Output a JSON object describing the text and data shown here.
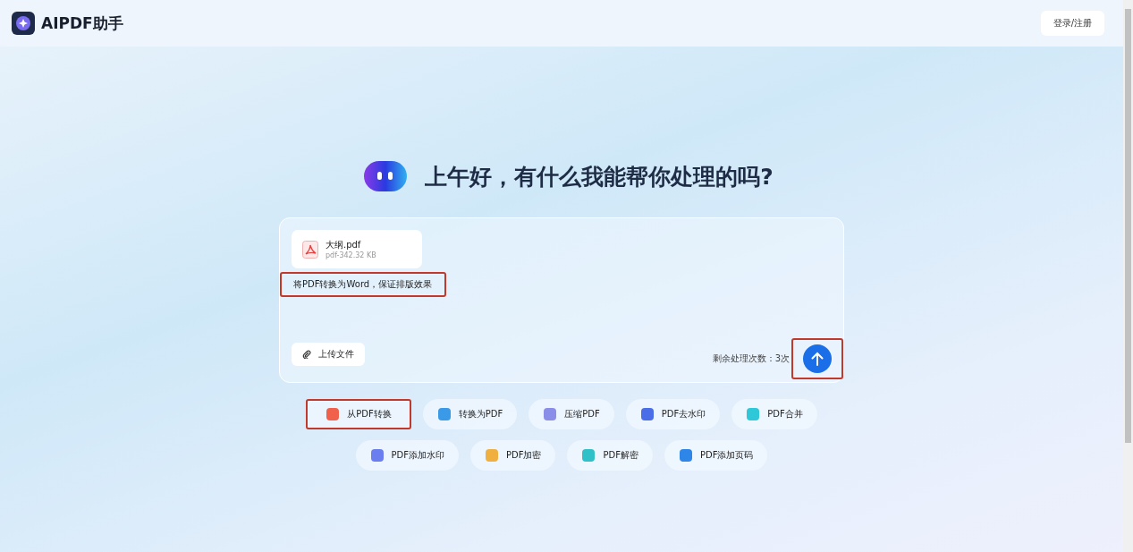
{
  "header": {
    "logo": "AIPDF助手",
    "login": "登录/注册"
  },
  "greeting": "上午好，有什么我能帮你处理的吗?",
  "composer": {
    "file": {
      "name": "大纲.pdf",
      "meta": "pdf-342.32 KB"
    },
    "prompt": {
      "text": "将PDF转换为Word，保证排版效果",
      "highlighted": true
    },
    "upload": "上传文件",
    "remaining": "剩余处理次数：3次",
    "send_highlighted": true
  },
  "tool_rows": [
    [
      {
        "label": "从PDF转换",
        "color": "#f0604a",
        "highlighted": true
      },
      {
        "label": "转换为PDF",
        "color": "#3a9ae8",
        "highlighted": false
      },
      {
        "label": "压缩PDF",
        "color": "#8a8ee8",
        "highlighted": false
      },
      {
        "label": "PDF去水印",
        "color": "#4a6ee8",
        "highlighted": false
      },
      {
        "label": "PDF合并",
        "color": "#2ec8d8",
        "highlighted": false
      }
    ],
    [
      {
        "label": "PDF添加水印",
        "color": "#6a7ef0",
        "highlighted": false
      },
      {
        "label": "PDF加密",
        "color": "#f0b040",
        "highlighted": false
      },
      {
        "label": "PDF解密",
        "color": "#30c0c8",
        "highlighted": false
      },
      {
        "label": "PDF添加页码",
        "color": "#2e86e8",
        "highlighted": false
      }
    ]
  ]
}
